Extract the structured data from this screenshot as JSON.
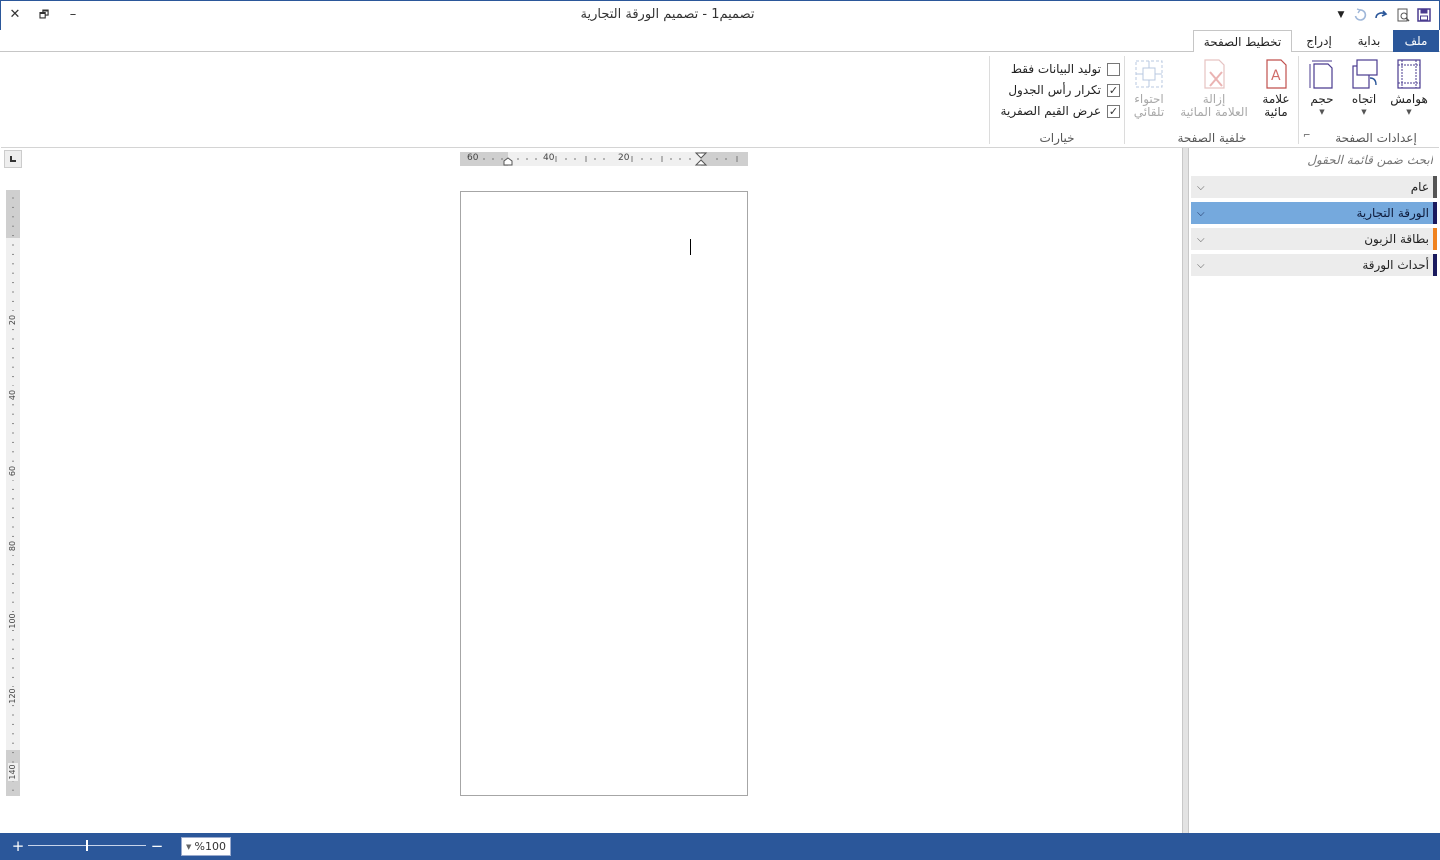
{
  "window": {
    "title": "تصميم1 - تصميم الورقة التجارية",
    "close_glyph": "✕",
    "restore_glyph": "🗗",
    "minimize_glyph": "–"
  },
  "tabs": [
    {
      "label": "ملف"
    },
    {
      "label": "بداية"
    },
    {
      "label": "إدراج"
    },
    {
      "label": "تخطيط الصفحة"
    }
  ],
  "ribbon": {
    "page_setup": {
      "group_label": "إعدادات الصفحة",
      "margins": "هوامش",
      "orientation": "اتجاه",
      "size": "حجم"
    },
    "page_background": {
      "group_label": "خلفية الصفحة",
      "watermark_line1": "علامة",
      "watermark_line2": "مائية",
      "remove_watermark_line1": "إزالة",
      "remove_watermark_line2": "العلامة المائية",
      "autofit_line1": "احتواء",
      "autofit_line2": "تلقائي"
    },
    "options": {
      "group_label": "خيارات",
      "data_only": {
        "label": "توليد البيانات فقط",
        "checked": false
      },
      "repeat_header": {
        "label": "تكرار رأس الجدول",
        "checked": true
      },
      "show_zero": {
        "label": "عرض القيم الصفرية",
        "checked": true
      }
    }
  },
  "field_panel": {
    "search_placeholder": "ابحث ضمن قائمة الحقول",
    "sections": [
      {
        "label": "عام",
        "accent": "#555555",
        "selected": false
      },
      {
        "label": "الورقة التجارية",
        "accent": "#1a1a5e",
        "selected": true
      },
      {
        "label": "بطاقة الزبون",
        "accent": "#f0821e",
        "selected": false
      },
      {
        "label": "أحداث الورقة",
        "accent": "#1a1a5e",
        "selected": false
      }
    ]
  },
  "rulers": {
    "horizontal_labels": [
      "60",
      "40",
      "20"
    ],
    "vertical_labels": [
      "20",
      "40",
      "60",
      "80",
      "100",
      "120",
      "140"
    ]
  },
  "status": {
    "zoom_value": "%100",
    "zoom_in": "+",
    "zoom_out": "−"
  },
  "colors": {
    "accent": "#2b579a",
    "selected_section": "#75a9dd"
  }
}
